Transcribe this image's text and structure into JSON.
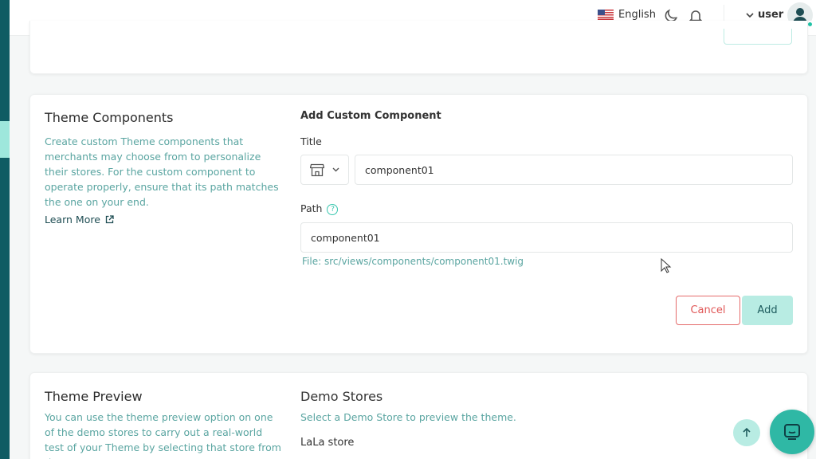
{
  "topbar": {
    "language": "English",
    "username": "user"
  },
  "components": {
    "title": "Theme Components",
    "description": "Create custom Theme components that merchants may choose from to personalize their stores. For the custom component to operate properly, ensure that its path matches the one on your end.",
    "learn_more": "Learn More",
    "form_title": "Add Custom Component",
    "title_label": "Title",
    "title_value": "component01",
    "path_label": "Path",
    "path_value": "component01",
    "file_hint": "File: src/views/components/component01.twig",
    "cancel_label": "Cancel",
    "add_label": "Add"
  },
  "preview": {
    "title": "Theme Preview",
    "description": "You can use the theme preview option on one of the demo stores to carry out a real-world test of your Theme by selecting that store from the",
    "demo_title": "Demo Stores",
    "demo_sub": "Select a Demo Store to preview the theme.",
    "store_name": "LaLa store"
  },
  "colors": {
    "accent": "#2fb8a5",
    "sidebar": "#0f5c63",
    "cancel": "#e05757"
  }
}
